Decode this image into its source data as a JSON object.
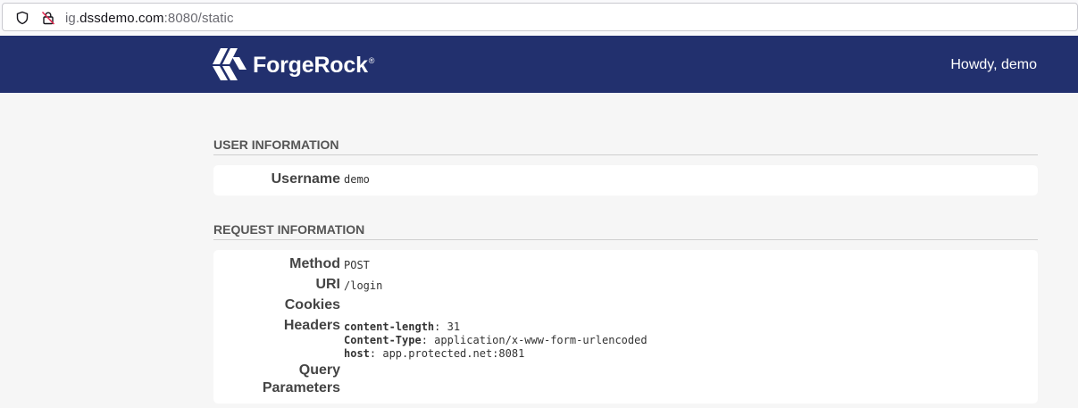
{
  "browser": {
    "url_prefix": "ig.",
    "url_host": "dssdemo.com",
    "url_suffix": ":8080/static",
    "shield_icon": "shield-icon",
    "lock_icon": "insecure-lock-icon"
  },
  "header": {
    "brand": "ForgeRock",
    "brand_mark": "®",
    "greeting": "Howdy, demo",
    "bg_color": "#22306e"
  },
  "user_info": {
    "title": "USER INFORMATION",
    "username_label": "Username",
    "username_value": "demo"
  },
  "request_info": {
    "title": "REQUEST INFORMATION",
    "method_label": "Method",
    "method_value": "POST",
    "uri_label": "URI",
    "uri_value": "/login",
    "cookies_label": "Cookies",
    "headers_label": "Headers",
    "headers": [
      {
        "name": "content-length",
        "value": "31"
      },
      {
        "name": "Content-Type",
        "value": "application/x-www-form-urlencoded"
      },
      {
        "name": "host",
        "value": "app.protected.net:8081"
      }
    ],
    "query_label_line1": "Query",
    "query_label_line2": "Parameters"
  }
}
